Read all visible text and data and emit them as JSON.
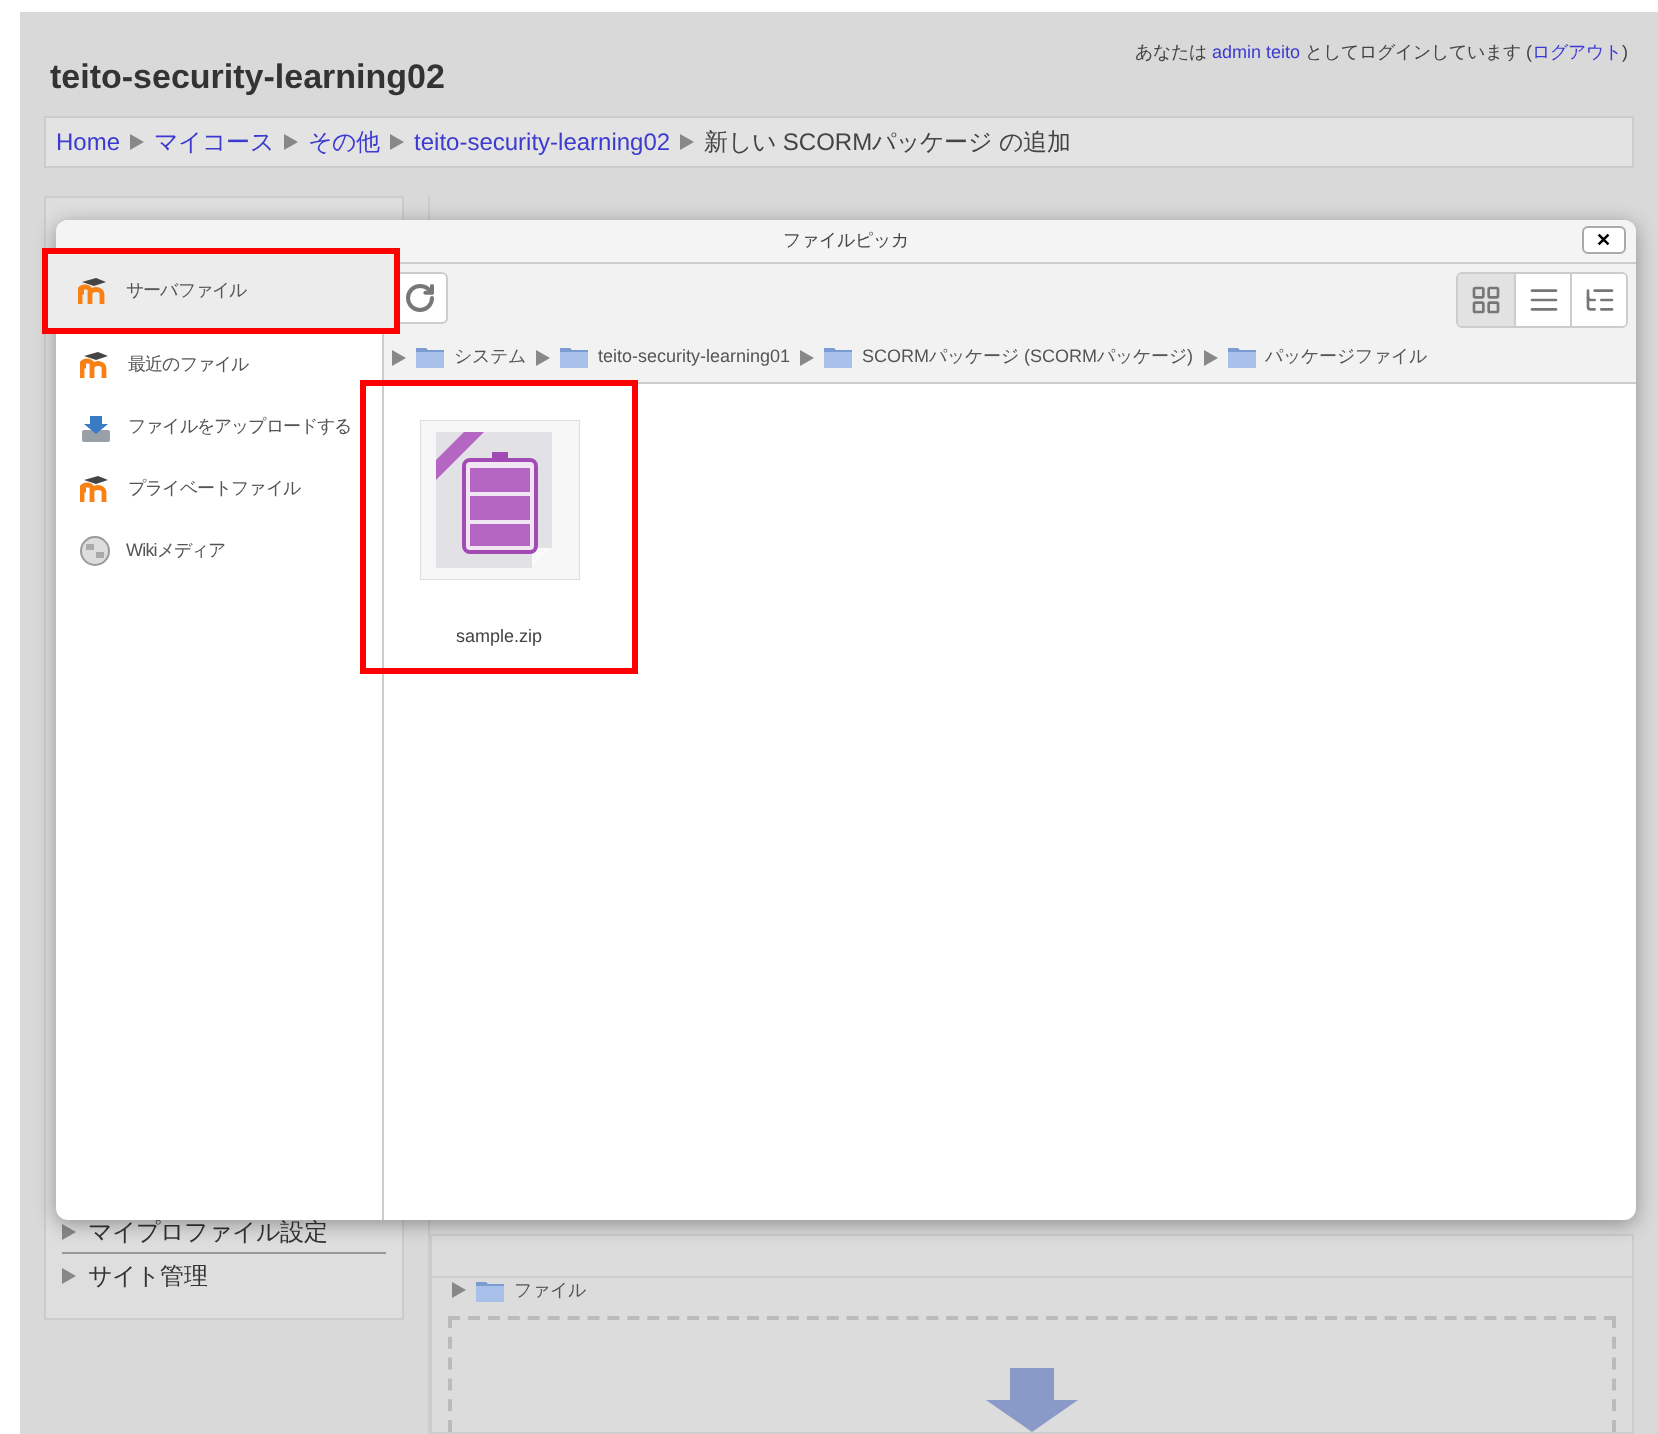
{
  "header": {
    "site_title": "teito-security-learning02",
    "login_prefix": "あなたは",
    "user_link": "admin teito",
    "login_middle": "としてログインしています (",
    "logout_link": "ログアウト",
    "login_end": ")"
  },
  "breadcrumb": [
    {
      "label": "Home",
      "link": true
    },
    {
      "label": "マイコース",
      "link": true
    },
    {
      "label": "その他",
      "link": true
    },
    {
      "label": "teito-security-learning02",
      "link": true
    },
    {
      "label": "新しい SCORMパッケージ の追加",
      "link": false
    }
  ],
  "nav_block": {
    "items": [
      {
        "label": "マイプロファイル設定"
      },
      {
        "label": "サイト管理"
      }
    ]
  },
  "file_manager": {
    "path": "ファイル"
  },
  "file_picker": {
    "title": "ファイルピッカ",
    "close": "✕",
    "repositories": [
      {
        "label": "サーバファイル",
        "kind": "moodle",
        "selected": true,
        "highlighted": true
      },
      {
        "label": "最近のファイル",
        "kind": "moodle",
        "selected": false,
        "highlighted": false
      },
      {
        "label": "ファイルをアップロードする",
        "kind": "upload",
        "selected": false,
        "highlighted": false
      },
      {
        "label": "プライベートファイル",
        "kind": "moodle",
        "selected": false,
        "highlighted": false
      },
      {
        "label": "Wikiメディア",
        "kind": "wiki",
        "selected": false,
        "highlighted": false
      }
    ],
    "path": [
      "システム",
      "teito-security-learning01",
      "SCORMパッケージ (SCORMパッケージ)",
      "パッケージファイル"
    ],
    "view_modes": [
      {
        "kind": "icons",
        "selected": true
      },
      {
        "kind": "list",
        "selected": false
      },
      {
        "kind": "tree",
        "selected": false
      }
    ],
    "files": [
      {
        "name": "sample.zip",
        "highlighted": true
      }
    ]
  }
}
